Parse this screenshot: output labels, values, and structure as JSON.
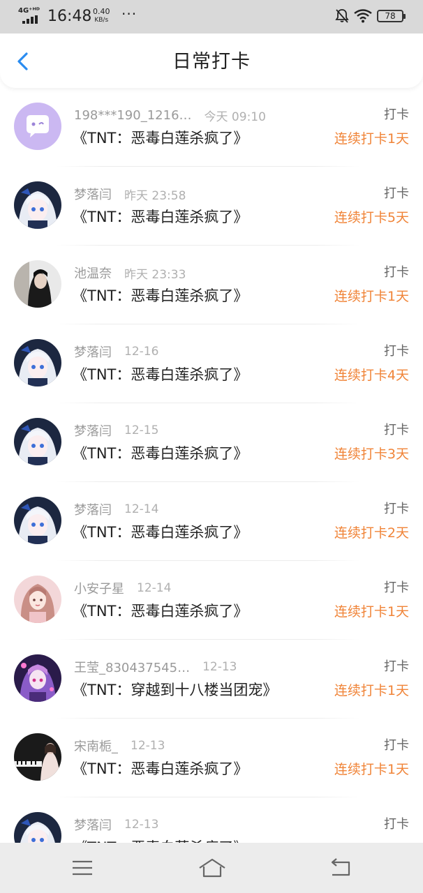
{
  "status_bar": {
    "network": "4G⁺ᴴᴰ",
    "time": "16:48",
    "speed_value": "0.40",
    "speed_unit": "KB/s",
    "dots": "···",
    "battery": "78"
  },
  "header": {
    "title": "日常打卡",
    "back_icon": "chevron-left-icon"
  },
  "colors": {
    "accent_back": "#2a8cf0",
    "streak": "#f08438",
    "title": "#222222",
    "meta": "#9a9a9a"
  },
  "checkins": [
    {
      "user": "198***190_1216…",
      "time": "今天 09:10",
      "book": "《TNT：恶毒白莲杀疯了》",
      "action": "打卡",
      "streak": "连续打卡1天",
      "avatar": "default-chat-avatar"
    },
    {
      "user": "梦落闫",
      "time": "昨天 23:58",
      "book": "《TNT：恶毒白莲杀疯了》",
      "action": "打卡",
      "streak": "连续打卡5天",
      "avatar": "anime-white-hair-avatar"
    },
    {
      "user": "池温奈",
      "time": "昨天 23:33",
      "book": "《TNT：恶毒白莲杀疯了》",
      "action": "打卡",
      "streak": "连续打卡1天",
      "avatar": "dark-girl-photo-avatar"
    },
    {
      "user": "梦落闫",
      "time": "12-16",
      "book": "《TNT：恶毒白莲杀疯了》",
      "action": "打卡",
      "streak": "连续打卡4天",
      "avatar": "anime-white-hair-avatar"
    },
    {
      "user": "梦落闫",
      "time": "12-15",
      "book": "《TNT：恶毒白莲杀疯了》",
      "action": "打卡",
      "streak": "连续打卡3天",
      "avatar": "anime-white-hair-avatar"
    },
    {
      "user": "梦落闫",
      "time": "12-14",
      "book": "《TNT：恶毒白莲杀疯了》",
      "action": "打卡",
      "streak": "连续打卡2天",
      "avatar": "anime-white-hair-avatar"
    },
    {
      "user": "小安子星",
      "time": "12-14",
      "book": "《TNT：恶毒白莲杀疯了》",
      "action": "打卡",
      "streak": "连续打卡1天",
      "avatar": "pink-girl-avatar"
    },
    {
      "user": "王莹_830437545…",
      "time": "12-13",
      "book": "《TNT：穿越到十八楼当团宠》",
      "action": "打卡",
      "streak": "连续打卡1天",
      "avatar": "purple-anime-avatar"
    },
    {
      "user": "宋南栀_",
      "time": "12-13",
      "book": "《TNT：恶毒白莲杀疯了》",
      "action": "打卡",
      "streak": "连续打卡1天",
      "avatar": "piano-photo-avatar"
    },
    {
      "user": "梦落闫",
      "time": "12-13",
      "book": "《TNT：恶毒白莲杀疯了》",
      "action": "打卡",
      "streak": "",
      "avatar": "anime-white-hair-avatar"
    }
  ],
  "nav_bar": {
    "menu_icon": "menu-icon",
    "home_icon": "home-icon",
    "back_icon": "back-arrow-icon"
  }
}
